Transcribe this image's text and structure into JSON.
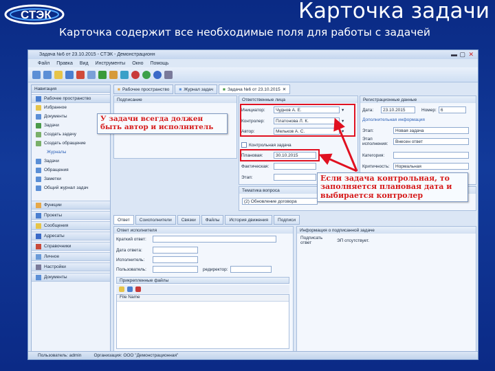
{
  "slide": {
    "title": "Карточка задачи",
    "subtitle": "Карточка содержит все необходимые поля для работы с задачей"
  },
  "window": {
    "title": "Задача №6 от 23.10.2015 - СТЭК - Демонстрационн",
    "menu": [
      "Файл",
      "Правка",
      "Вид",
      "Инструменты",
      "Окно",
      "Помощь"
    ]
  },
  "sidebar": {
    "header": "Навигация",
    "workspace": "Рабочее пространство",
    "items": [
      "Избранное",
      "Документы",
      "Задачи",
      "Создать задачу",
      "Создать обращение"
    ],
    "journals_label": "Журналы",
    "journal_items": [
      "Задачи",
      "Обращения",
      "Заметки",
      "Общий журнал задач"
    ],
    "groups": [
      "Функции",
      "Проекты",
      "Сообщения",
      "Адресаты",
      "Справочники",
      "Личное",
      "Настройки",
      "Документы"
    ]
  },
  "tabs": [
    "Рабочее пространство",
    "Журнал задач",
    "Задача №6 от 23.10.2015"
  ],
  "form": {
    "section_main": "Ответственные лица",
    "section_reg": "Регистрационные данные",
    "initiator_label": "Инициатор:",
    "initiator_value": "Чуднов А. Е.",
    "controller_label": "Контролер:",
    "controller_value": "Платонова Л. К.",
    "author_label": "Автор:",
    "author_value": "Мельков А. С.",
    "date_label": "Дата:",
    "date_value": "23.10.2015",
    "number_label": "Номер:",
    "number_value": "6",
    "extra_label": "Дополнительная информация",
    "control_label": "Контрольная задача",
    "planned_label": "Плановая:",
    "planned_value": "30.10.2015",
    "actual_label": "Фактическая:",
    "stage_label": "Этап:",
    "stage_value": "Новая задача",
    "exec_stage_label": "Этап исполнения:",
    "exec_stage_value": "Внесен ответ",
    "category_label": "Категория:",
    "criticality_label": "Критичность:",
    "criticality_value": "Нормальная",
    "topic_label": "Тематика вопроса",
    "topic_value": "(2) Обновление договора",
    "note_label": "Подписание"
  },
  "bottom_tabs": [
    "Ответ",
    "Соисполнители",
    "Связки",
    "Файлы",
    "История движения",
    "Подписи"
  ],
  "answer": {
    "section": "Ответ исполнителя",
    "short_label": "Краткий ответ:",
    "date_label": "Дата ответа:",
    "executor_label": "Исполнитель:",
    "user_label": "Пользователь:",
    "redirect_label": "редиректор:",
    "attach_label": "Прикрепленные файлы",
    "filename_header": "File Name",
    "info_label": "Информация о подписанной задаче",
    "sign_answer_label": "Подписать ответ",
    "sign_status": "ЭП отсутствует."
  },
  "status": {
    "left": "Пользователь: admin",
    "right": "Организация: ООО \"Демонстрационная\""
  },
  "annotations": {
    "author_note": "У задачи всегда должен быть автор и исполнитель",
    "control_note": "Если задача контрольная, то заполняется плановая дата и выбирается контролер"
  },
  "colors": {
    "background": "#0a2a84",
    "annotation_text": "#d61a1a",
    "highlight": "#e01020"
  }
}
